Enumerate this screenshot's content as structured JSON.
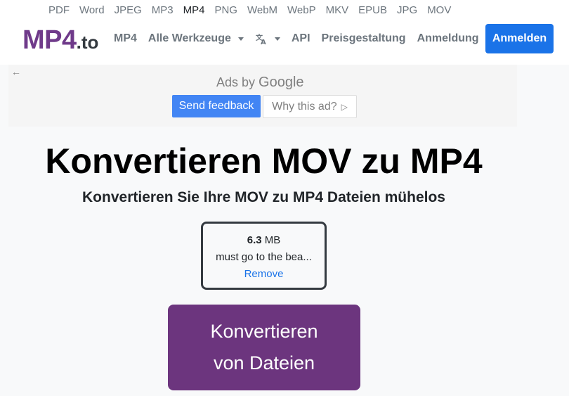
{
  "format_bar": {
    "items": [
      "PDF",
      "Word",
      "JPEG",
      "MP3",
      "MP4",
      "PNG",
      "WebM",
      "WebP",
      "MKV",
      "EPUB",
      "JPG",
      "MOV"
    ],
    "active": "MP4"
  },
  "navbar": {
    "logo_main": "MP4",
    "logo_tld": ".to",
    "links": {
      "mp4": "MP4",
      "tools": "Alle Werkzeuge",
      "api": "API",
      "pricing": "Preisgestaltung",
      "login": "Anmeldung"
    },
    "signup_label": "Anmelden"
  },
  "ad": {
    "ads_by": "Ads by",
    "google": "Google",
    "feedback_label": "Send feedback",
    "why_label": "Why this ad?"
  },
  "main": {
    "title": "Konvertieren MOV zu MP4",
    "subtitle": "Konvertieren Sie Ihre MOV zu MP4 Dateien mühelos",
    "file": {
      "size_value": "6.3",
      "size_unit": "MB",
      "name": "must go to the bea...",
      "remove_label": "Remove"
    },
    "convert_line1": "Konvertieren",
    "convert_line2": "von Dateien"
  },
  "colors": {
    "brand_purple": "#6c357e",
    "primary_blue": "#1a73e8",
    "ad_blue": "#4285f4"
  }
}
